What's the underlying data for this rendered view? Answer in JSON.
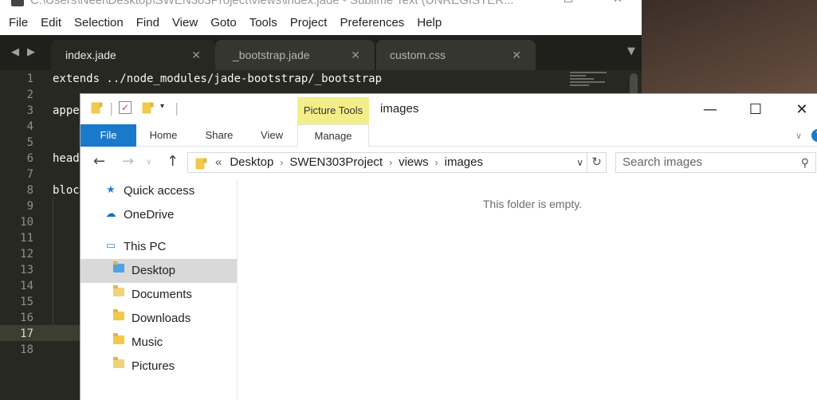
{
  "sublime": {
    "title": "C:\\Users\\Neel\\Desktop\\SWEN303Project\\views\\index.jade - Sublime Text (UNREGISTER...",
    "menu": [
      "File",
      "Edit",
      "Selection",
      "Find",
      "View",
      "Goto",
      "Tools",
      "Project",
      "Preferences",
      "Help"
    ],
    "tabs": [
      {
        "label": "index.jade",
        "active": true
      },
      {
        "label": "_bootstrap.jade",
        "active": false
      },
      {
        "label": "custom.css",
        "active": false
      }
    ],
    "line_numbers": [
      "1",
      "2",
      "3",
      "4",
      "5",
      "6",
      "7",
      "8",
      "9",
      "10",
      "11",
      "12",
      "13",
      "14",
      "15",
      "16",
      "17",
      "18"
    ],
    "current_line": 17,
    "code": {
      "line1": "extends ../node_modules/jade-bootstrap/_bootstrap",
      "line3": "appe",
      "line6": "head",
      "line8": "bloc"
    },
    "colors": {
      "background": "#272822",
      "text": "#f8f8f2",
      "gutter": "#90908a"
    }
  },
  "explorer": {
    "title": "images",
    "contextual_tab_group": "Picture Tools",
    "ribbon_tabs": [
      "File",
      "Home",
      "Share",
      "View",
      "Manage"
    ],
    "address_prefix": "«",
    "breadcrumb": [
      "Desktop",
      "SWEN303Project",
      "views",
      "images"
    ],
    "search_placeholder": "Search images",
    "nav": {
      "quick_access": "Quick access",
      "onedrive": "OneDrive",
      "this_pc": "This PC",
      "desktop": "Desktop",
      "documents": "Documents",
      "downloads": "Downloads",
      "music": "Music",
      "pictures": "Pictures"
    },
    "empty_message": "This folder is empty.",
    "colors": {
      "file_tab": "#1979ca",
      "picture_tools": "#f4ee8a",
      "selected_nav": "#d9d9d9"
    }
  }
}
